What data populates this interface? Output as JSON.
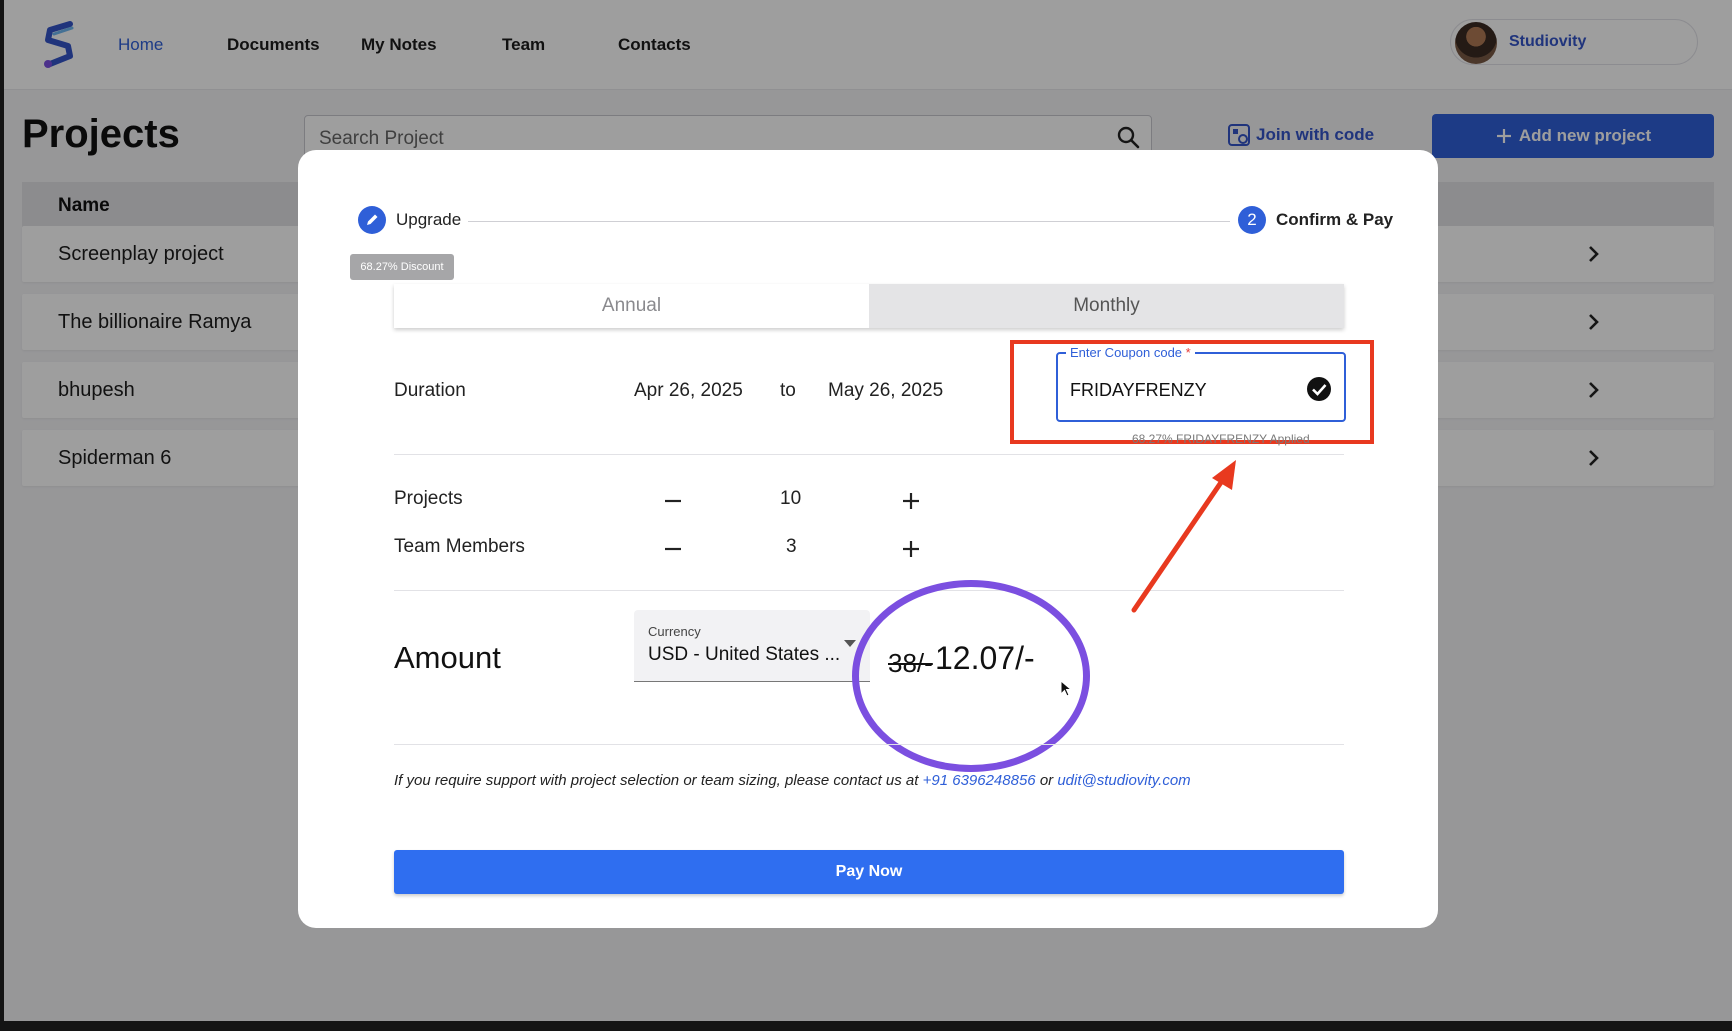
{
  "nav": {
    "items": [
      "Home",
      "Documents",
      "My Notes",
      "Team",
      "Contacts"
    ],
    "active": "Home",
    "profile_name": "Studiovity"
  },
  "page": {
    "title": "Projects",
    "search_placeholder": "Search Project",
    "join_label": "Join with code",
    "add_label": "Add new project"
  },
  "table": {
    "header": "Name",
    "rows": [
      "Screenplay project",
      "The billionaire Ramya",
      "bhupesh",
      "Spiderman 6"
    ]
  },
  "modal": {
    "steps": [
      {
        "marker": "",
        "label": "Upgrade"
      },
      {
        "marker": "2",
        "label": "Confirm & Pay"
      }
    ],
    "discount_badge": "68.27% Discount",
    "tabs": [
      "Annual",
      "Monthly"
    ],
    "selected_tab": "Monthly",
    "duration": {
      "label": "Duration",
      "from": "Apr 26, 2025",
      "to_word": "to",
      "to": "May 26, 2025"
    },
    "coupon": {
      "label": "Enter Coupon code",
      "required_mark": "*",
      "value": "FRIDAYFRENZY",
      "applied_text": "68.27% FRIDAYFRENZY Applied"
    },
    "projects": {
      "label": "Projects",
      "count": "10"
    },
    "team_members": {
      "label": "Team Members",
      "count": "3"
    },
    "amount": {
      "label": "Amount",
      "currency_label": "Currency",
      "currency_value": "USD - United States ...",
      "old_price": "38/-",
      "new_price": "12.07/-"
    },
    "support": {
      "text": "If you require support with project selection or team sizing, please contact us at",
      "phone": "+91 6396248856",
      "or_word": "or",
      "email": "udit@studiovity.com"
    },
    "pay_label": "Pay Now"
  },
  "colors": {
    "brand_blue": "#2f5fd8",
    "pay_blue": "#2f6ef0",
    "annotation_red": "#e8391f",
    "annotation_purple": "#7b4fe0"
  }
}
